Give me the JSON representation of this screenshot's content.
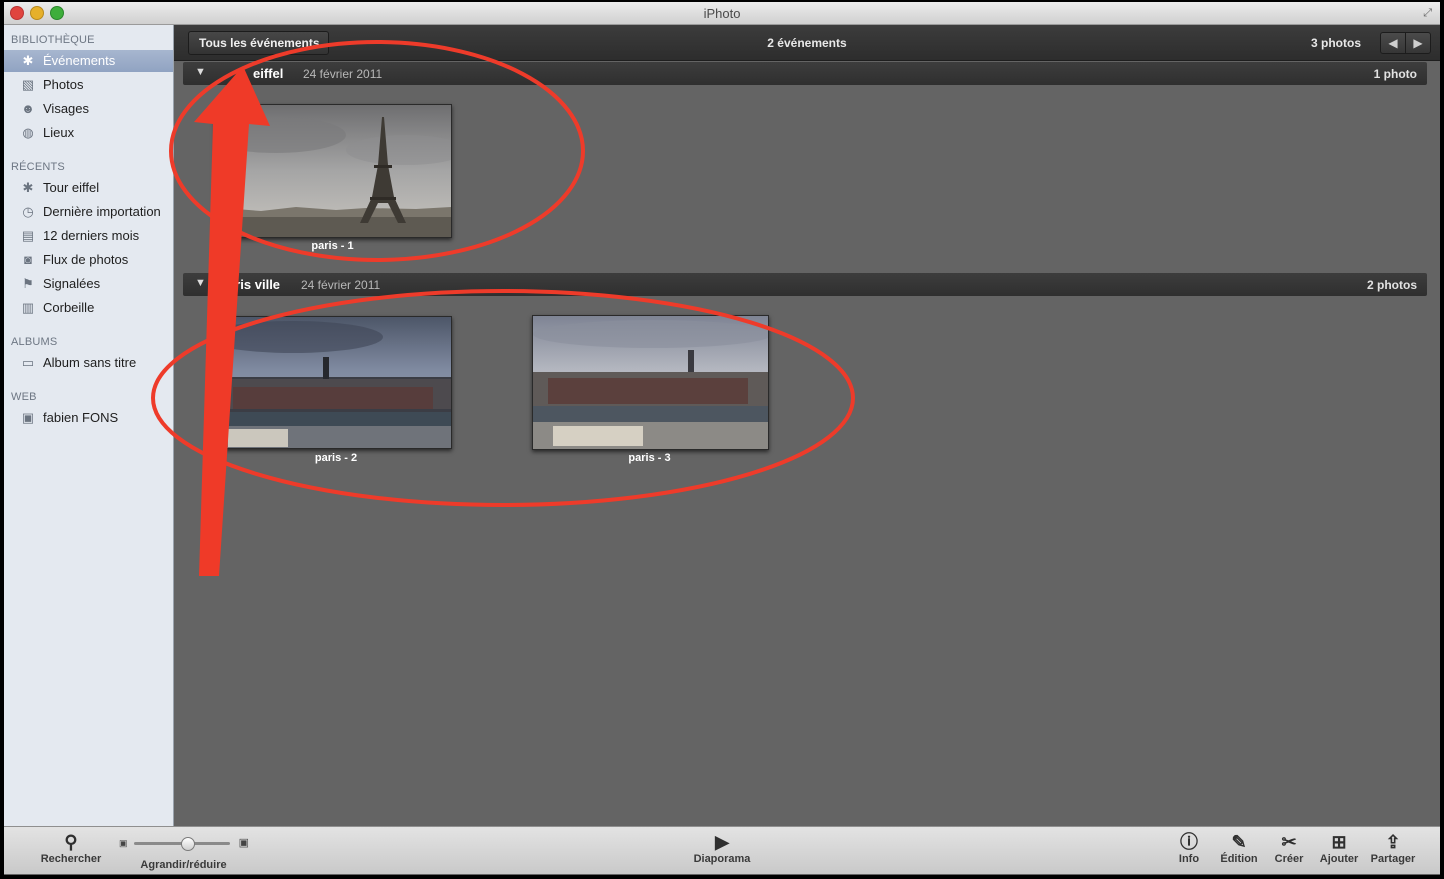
{
  "window": {
    "title": "iPhoto"
  },
  "sidebar": {
    "sections": [
      {
        "heading": "BIBLIOTHÈQUE",
        "items": [
          {
            "label": "Événements",
            "icon": "palm-tree-icon",
            "selected": true
          },
          {
            "label": "Photos",
            "icon": "photo-icon"
          },
          {
            "label": "Visages",
            "icon": "person-icon"
          },
          {
            "label": "Lieux",
            "icon": "globe-icon"
          }
        ]
      },
      {
        "heading": "RÉCENTS",
        "items": [
          {
            "label": "Tour eiffel",
            "icon": "palm-tree-icon"
          },
          {
            "label": "Dernière importation",
            "icon": "clock-icon"
          },
          {
            "label": "12 derniers mois",
            "icon": "calendar-icon"
          },
          {
            "label": "Flux de photos",
            "icon": "photo-stream-icon"
          },
          {
            "label": "Signalées",
            "icon": "flag-icon"
          },
          {
            "label": "Corbeille",
            "icon": "trash-icon"
          }
        ]
      },
      {
        "heading": "ALBUMS",
        "items": [
          {
            "label": "Album sans titre",
            "icon": "album-icon"
          }
        ]
      },
      {
        "heading": "WEB",
        "items": [
          {
            "label": "fabien FONS",
            "icon": "web-album-icon"
          }
        ]
      }
    ]
  },
  "header": {
    "back_label": "Tous les événements",
    "center_title": "2 événements",
    "photo_count": "3 photos",
    "prev_icon": "arrow-left-icon",
    "next_icon": "arrow-right-icon"
  },
  "events": [
    {
      "name": "Tour eiffel",
      "name_shown": "eiffel",
      "date": "24 février 2011",
      "count": "1 photo",
      "photos": [
        {
          "caption": "paris - 1",
          "subject": "eiffel-tower"
        }
      ]
    },
    {
      "name": "Paris ville",
      "name_shown": "aris ville",
      "date": "24 février 2011",
      "count": "2 photos",
      "photos": [
        {
          "caption": "paris - 2",
          "subject": "paris-skyline"
        },
        {
          "caption": "paris - 3",
          "subject": "paris-skyline"
        }
      ]
    }
  ],
  "toolbar": {
    "search": {
      "label": "Rechercher",
      "icon": "magnifier-icon"
    },
    "zoom": {
      "label": "Agrandir/réduire",
      "value": 0.55
    },
    "slideshow": {
      "label": "Diaporama",
      "icon": "play-icon"
    },
    "info": {
      "label": "Info",
      "icon": "info-icon"
    },
    "edit": {
      "label": "Édition",
      "icon": "pencil-icon"
    },
    "create": {
      "label": "Créer",
      "icon": "create-icon"
    },
    "add": {
      "label": "Ajouter",
      "icon": "plus-icon"
    },
    "share": {
      "label": "Partager",
      "icon": "share-icon"
    }
  },
  "colors": {
    "annotation": "#ee3b2a",
    "sidebar_selected": "#97a8c6",
    "content_bg": "#646464"
  }
}
